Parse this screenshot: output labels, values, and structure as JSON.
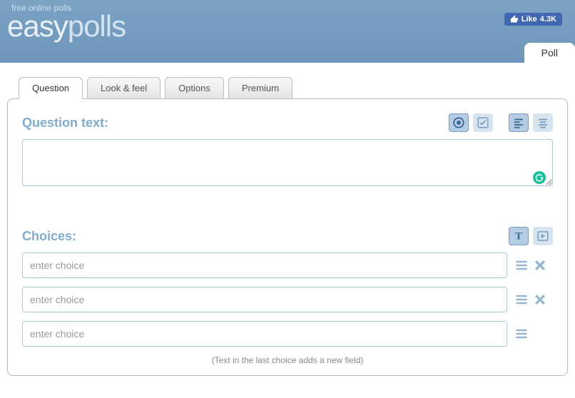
{
  "header": {
    "tagline": "free online polls",
    "logo_easy": "easy",
    "logo_polls": "polls",
    "like_label": "Like",
    "like_count": "4.3K",
    "poll_tab": "Poll"
  },
  "tabs": [
    {
      "label": "Question",
      "active": true
    },
    {
      "label": "Look & feel",
      "active": false
    },
    {
      "label": "Options",
      "active": false
    },
    {
      "label": "Premium",
      "active": false
    }
  ],
  "question": {
    "label": "Question text:",
    "value": ""
  },
  "choices": {
    "label": "Choices:",
    "placeholder": "enter choice",
    "hint": "(Text in the last choice adds a new field)",
    "items": [
      {
        "value": "",
        "removable": true
      },
      {
        "value": "",
        "removable": true
      },
      {
        "value": "",
        "removable": false
      }
    ]
  },
  "icons": {
    "radio": "radio-icon",
    "check": "check-icon",
    "align_left": "align-left-icon",
    "align_center": "align-center-icon",
    "text": "text-icon",
    "media": "media-icon",
    "drag": "drag-icon",
    "remove": "remove-icon"
  }
}
